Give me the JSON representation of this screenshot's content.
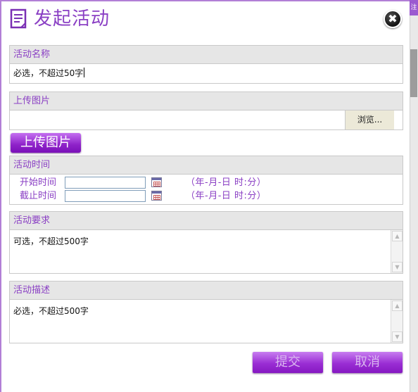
{
  "dialog": {
    "title": "发起活动",
    "close_glyph": "✖",
    "title_icon": "document-icon"
  },
  "sections": {
    "name": {
      "header": "活动名称",
      "value": "必选，不超过50字"
    },
    "image": {
      "header": "上传图片",
      "browse_label": "浏览...",
      "upload_label": "上传图片"
    },
    "time": {
      "header": "活动时间",
      "start_label": "开始时间",
      "end_label": "截止时间",
      "start_value": "",
      "end_value": "",
      "format_hint": "（年-月-日 时:分）"
    },
    "requirements": {
      "header": "活动要求",
      "value": "可选，不超过500字"
    },
    "description": {
      "header": "活动描述",
      "value": "必选，不超过500字"
    }
  },
  "actions": {
    "submit_label": "提交",
    "cancel_label": "取消"
  },
  "colors": {
    "accent": "#8a3fc4",
    "button_purple": "#9a2ed4",
    "header_bg": "#e6e6e6"
  }
}
